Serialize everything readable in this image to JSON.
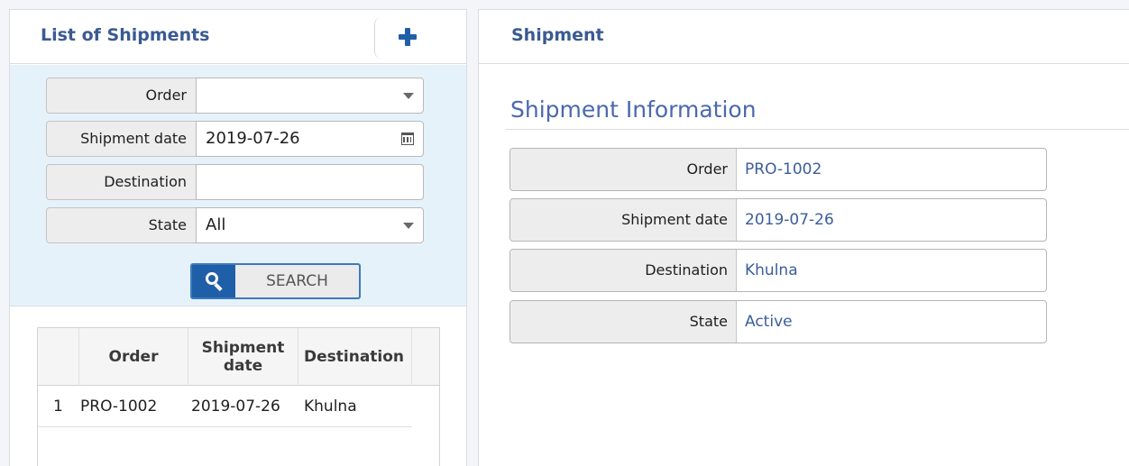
{
  "left": {
    "title": "List of Shipments",
    "filters": {
      "order": {
        "label": "Order",
        "value": ""
      },
      "shipment_date": {
        "label": "Shipment date",
        "value": "2019-07-26"
      },
      "destination": {
        "label": "Destination",
        "value": ""
      },
      "state": {
        "label": "State",
        "value": "All"
      }
    },
    "search_label": "SEARCH",
    "grid": {
      "columns": [
        "Order",
        "Shipment date",
        "Destination"
      ],
      "rows": [
        {
          "num": "1",
          "order": "PRO-1002",
          "date": "2019-07-26",
          "destination": "Khulna"
        }
      ]
    }
  },
  "right": {
    "title": "Shipment",
    "section_title": "Shipment Information",
    "fields": [
      {
        "label": "Order",
        "value": "PRO-1002"
      },
      {
        "label": "Shipment date",
        "value": "2019-07-26"
      },
      {
        "label": "Destination",
        "value": "Khulna"
      },
      {
        "label": "State",
        "value": "Active"
      }
    ]
  }
}
